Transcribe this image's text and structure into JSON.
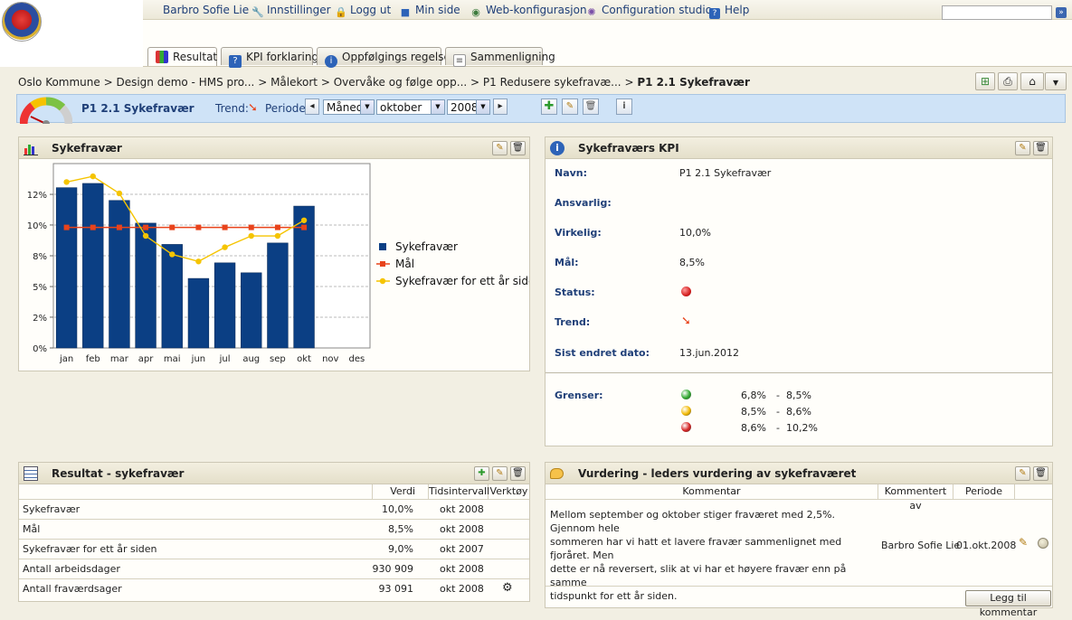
{
  "header": {
    "links": [
      {
        "label": "Barbro Sofie Lie",
        "icon": "user-icon"
      },
      {
        "label": "Innstillinger",
        "icon": "wrench-icon"
      },
      {
        "label": "Logg ut",
        "icon": "lock-icon"
      },
      {
        "label": "Min side",
        "icon": "book-icon"
      },
      {
        "label": "Web-konfigurasjon",
        "icon": "globe-gear-icon"
      },
      {
        "label": "Configuration studio",
        "icon": "studio-icon"
      },
      {
        "label": "Help",
        "icon": "help-icon"
      }
    ],
    "search_value": ""
  },
  "tabs": [
    {
      "label": "Resultat",
      "icon": "chart-icon",
      "active": true
    },
    {
      "label": "KPI forklaring",
      "icon": "help-book-icon",
      "active": false
    },
    {
      "label": "Oppfølgings regelsett",
      "icon": "info-icon",
      "active": false
    },
    {
      "label": "Sammenligning",
      "icon": "document-icon",
      "active": false
    }
  ],
  "breadcrumb": {
    "items": [
      "Oslo Kommune",
      "Design demo - HMS pro...",
      "Målekort",
      "Overvåke og følge opp...",
      "P1 Redusere sykefravæ..."
    ],
    "current": "P1 2.1 Sykefravær"
  },
  "period_bar": {
    "title": "P1 2.1 Sykefravær",
    "trend_label": "Trend:",
    "period_label": "Periode:",
    "period_type": "Måned",
    "month": "oktober",
    "year": "2008"
  },
  "chart_panel": {
    "title": "Sykefravær"
  },
  "chart_data": {
    "type": "bar",
    "categories": [
      "jan",
      "feb",
      "mar",
      "apr",
      "mai",
      "jun",
      "jul",
      "aug",
      "sep",
      "okt",
      "nov",
      "des"
    ],
    "ylim": [
      0,
      13
    ],
    "yticks": [
      "0%",
      "2%",
      "5%",
      "8%",
      "10%",
      "12%"
    ],
    "ytick_values": [
      0,
      2.17,
      4.33,
      6.5,
      8.67,
      10.83
    ],
    "series": [
      {
        "name": "Sykefravær",
        "type": "bar",
        "color": "#0b3f84",
        "values": [
          11.3,
          11.6,
          10.4,
          8.8,
          7.3,
          4.9,
          6.0,
          5.3,
          7.4,
          10.0,
          null,
          null
        ]
      },
      {
        "name": "Mål",
        "type": "line",
        "color": "#e8431b",
        "values": [
          8.5,
          8.5,
          8.5,
          8.5,
          8.5,
          8.5,
          8.5,
          8.5,
          8.5,
          8.5,
          null,
          null
        ]
      },
      {
        "name": "Sykefravær for ett år siden",
        "type": "line",
        "color": "#f5c400",
        "values": [
          11.7,
          12.1,
          10.9,
          7.9,
          6.6,
          6.1,
          7.1,
          7.9,
          7.9,
          9.0,
          null,
          null
        ]
      }
    ],
    "legend": "right"
  },
  "kpi_panel": {
    "title": "Sykefraværs KPI",
    "fields": [
      {
        "label": "Navn:",
        "value": "P1 2.1 Sykefravær"
      },
      {
        "label": "Ansvarlig:",
        "value": ""
      },
      {
        "label": "Virkelig:",
        "value": "10,0%"
      },
      {
        "label": "Mål:",
        "value": "8,5%"
      },
      {
        "label": "Status:",
        "value": ""
      },
      {
        "label": "Trend:",
        "value": ""
      },
      {
        "label": "Sist endret dato:",
        "value": "13.jun.2012"
      }
    ],
    "limits_label": "Grenser:",
    "limits": [
      {
        "color": "#2fa82f",
        "from": "6,8%",
        "to": "8,5%"
      },
      {
        "color": "#f2b800",
        "from": "8,5%",
        "to": "8,6%"
      },
      {
        "color": "#d42020",
        "from": "8,6%",
        "to": "10,2%"
      }
    ],
    "status_color": "#d42020"
  },
  "result_panel": {
    "title": "Resultat - sykefravær",
    "columns": [
      "",
      "Verdi",
      "Tidsintervall",
      "Verktøy"
    ],
    "rows": [
      {
        "name": "Sykefravær",
        "value": "10,0%",
        "interval": "okt 2008"
      },
      {
        "name": "Mål",
        "value": "8,5%",
        "interval": "okt 2008"
      },
      {
        "name": "Sykefravær for ett år siden",
        "value": "9,0%",
        "interval": "okt 2007"
      },
      {
        "name": "Antall arbeidsdager",
        "value": "930 909",
        "interval": "okt 2008"
      },
      {
        "name": "Antall fraværdsager",
        "value": "93 091",
        "interval": "okt 2008"
      }
    ]
  },
  "comment_panel": {
    "title": "Vurdering - leders vurdering av sykefraværet",
    "columns": [
      "Kommentar",
      "Kommentert av",
      "Periode"
    ],
    "comment": {
      "lines": [
        "Mellom september og oktober stiger fraværet med 2,5%. Gjennom hele",
        "sommeren har vi hatt et lavere fravær sammenlignet med fjoråret. Men",
        "dette er nå reversert, slik at vi har et høyere fravær enn på samme",
        "tidspunkt for ett år siden."
      ],
      "author": "Barbro Sofie Lie",
      "period": "01.okt.2008"
    },
    "add_button": "Legg til kommentar"
  }
}
